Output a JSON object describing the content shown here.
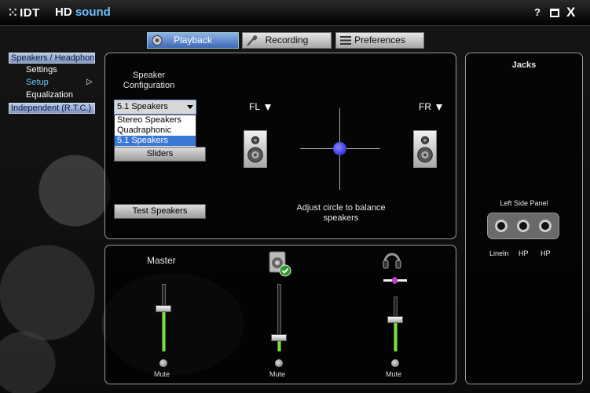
{
  "window": {
    "logo": "IDT",
    "product_main": "HD",
    "product_accent": "sound",
    "help_label": "?",
    "close_label": "X"
  },
  "tabs": [
    {
      "label": "Playback",
      "active": true
    },
    {
      "label": "Recording",
      "active": false
    },
    {
      "label": "Preferences",
      "active": false
    }
  ],
  "nav": {
    "speakers_headphones": "Speakers / Headphones",
    "settings": "Settings",
    "setup": "Setup",
    "setup_arrow": "▷",
    "equalization": "Equalization",
    "independent": "Independent (R.T.C.) Headphones"
  },
  "config": {
    "title": "Speaker Configuration",
    "selected": "5.1 Speakers",
    "options": [
      "Stereo Speakers",
      "Quadraphonic",
      "5.1 Speakers"
    ],
    "sliders_button": "Sliders",
    "test_button": "Test Speakers",
    "fl_label": "FL",
    "fr_label": "FR",
    "balance_hint": "Adjust circle to balance speakers"
  },
  "mixer": {
    "master_label": "Master",
    "mute_label": "Mute",
    "levels": {
      "master": 0.63,
      "device2": 0.2,
      "device3": 0.57
    }
  },
  "jacks": {
    "title": "Jacks",
    "location": "Left Side Panel",
    "labels": [
      "LineIn",
      "HP",
      "HP"
    ]
  },
  "colors": {
    "accent_blue": "#6ec6ff",
    "level_green": "#66ee22",
    "balance_dot": "#3434dd"
  }
}
